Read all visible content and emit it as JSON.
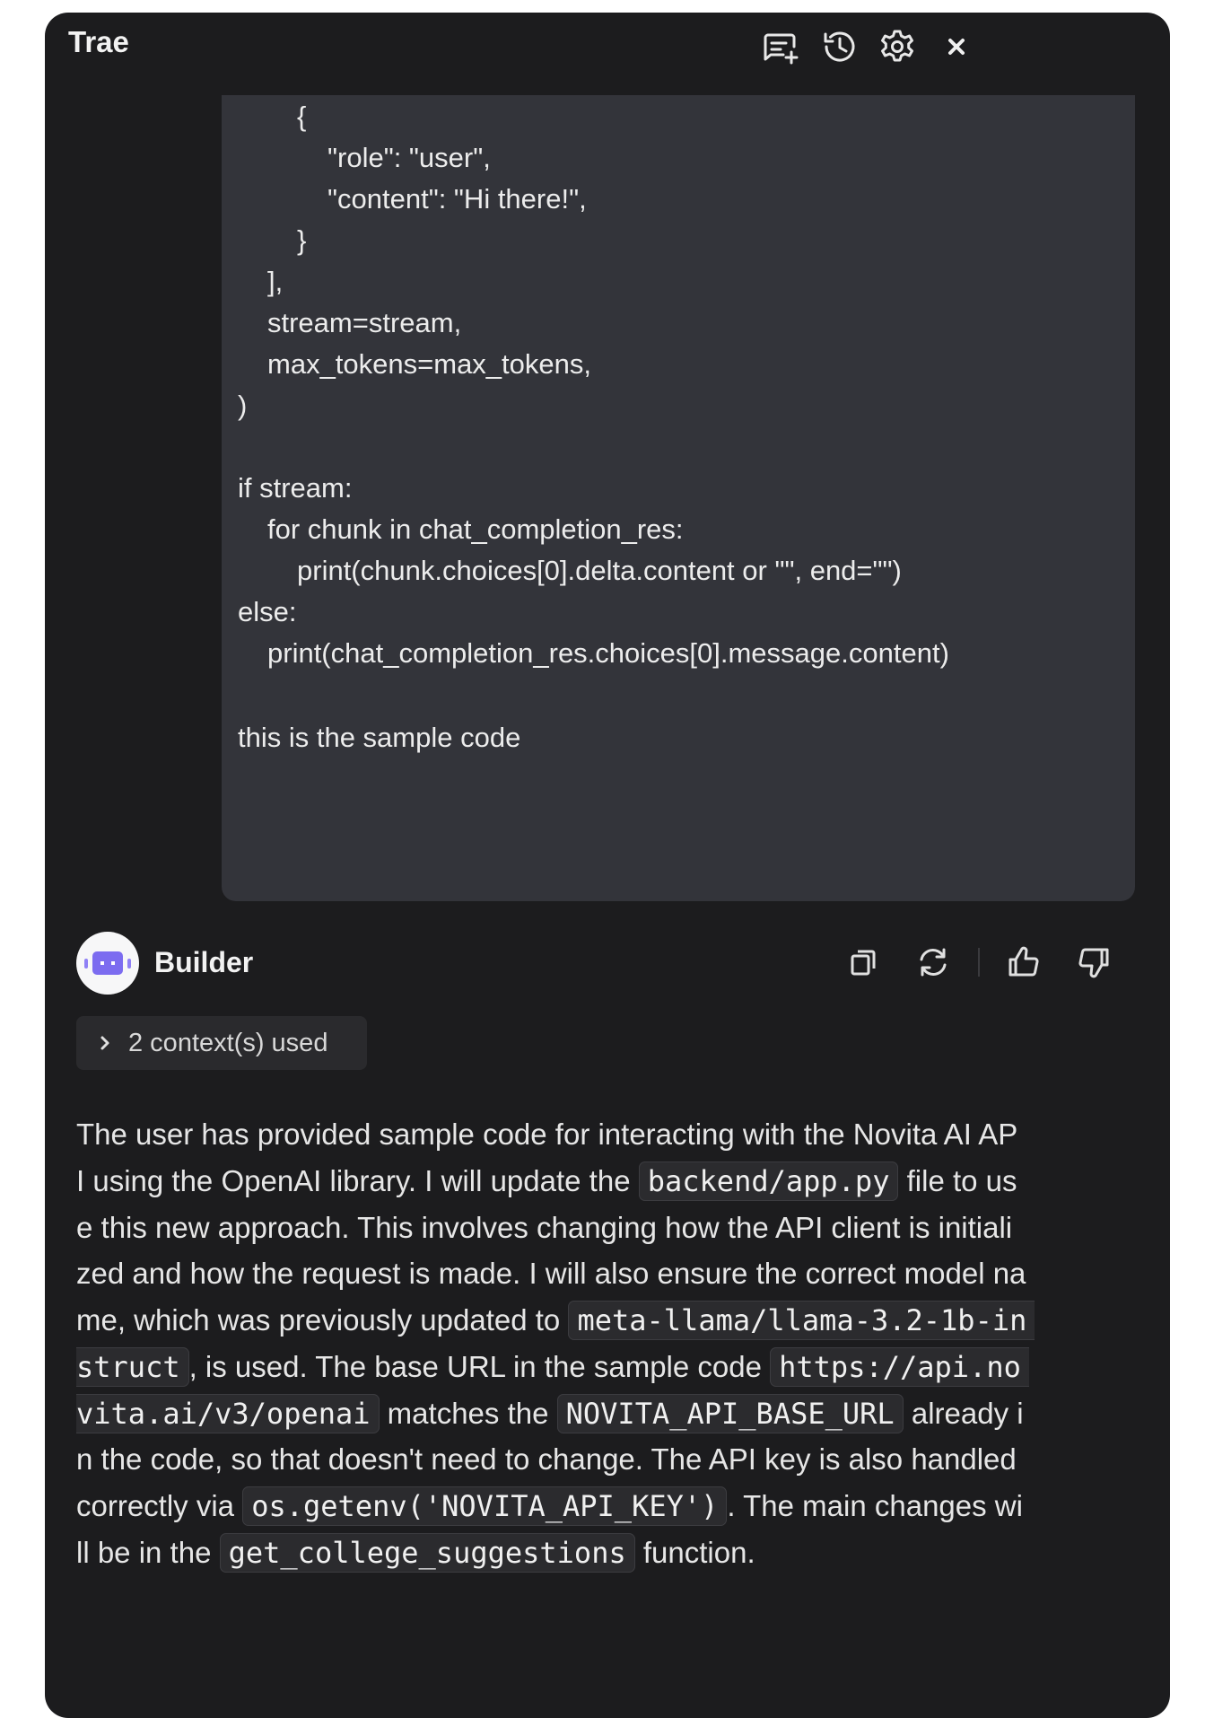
{
  "app": {
    "title": "Trae"
  },
  "header": {
    "icons": [
      "new-chat-icon",
      "history-icon",
      "gear-icon",
      "close-icon"
    ]
  },
  "user_message": {
    "lines": [
      "{",
      "\"role\": \"user\",",
      "\"content\": \"Hi there!\",",
      "}",
      "],",
      "stream=stream,",
      "max_tokens=max_tokens,",
      ")",
      "if stream:",
      "for chunk in chat_completion_res:",
      "print(chunk.choices[0].delta.content or \"\", end=\"\")",
      "else:",
      "print(chat_completion_res.choices[0].message.content)",
      "this is the sample code"
    ]
  },
  "assistant": {
    "name": "Builder",
    "actions": [
      "copy-icon",
      "regenerate-icon",
      "thumbs-up-icon",
      "thumbs-down-icon"
    ],
    "context_label": "2 context(s) used",
    "paragraph": {
      "l1": "The user has provided sample code for interacting with the Novita AI AP",
      "l2a": "I using the OpenAI library. I will update the ",
      "l2code": "backend/app.py",
      "l2b": " file to us",
      "l3": "e this new approach. This involves changing how the API client is initiali",
      "l4": "zed and how the request is made. I will also ensure the correct model na",
      "l5a": "me, which was previously updated to ",
      "l5code": "meta-llama/llama-3.2-1b-in",
      "l6code": "struct",
      "l6a": ", is used. The base URL in the sample code ",
      "l6code2": "https://api.no",
      "l7code": "vita.ai/v3/openai",
      "l7a": " matches the ",
      "l7code2": "NOVITA_API_BASE_URL",
      "l7b": " already i",
      "l8": "n the code, so that doesn't need to change. The API key is also handled",
      "l9a": "correctly via ",
      "l9code": "os.getenv('NOVITA_API_KEY')",
      "l9b": ". The main changes wi",
      "l10a": "ll be in the ",
      "l10code": "get_college_suggestions",
      "l10b": " function."
    }
  },
  "colors": {
    "panel": "#1c1c1e",
    "user_bubble": "#33343a",
    "accent": "#7c6cf0"
  }
}
